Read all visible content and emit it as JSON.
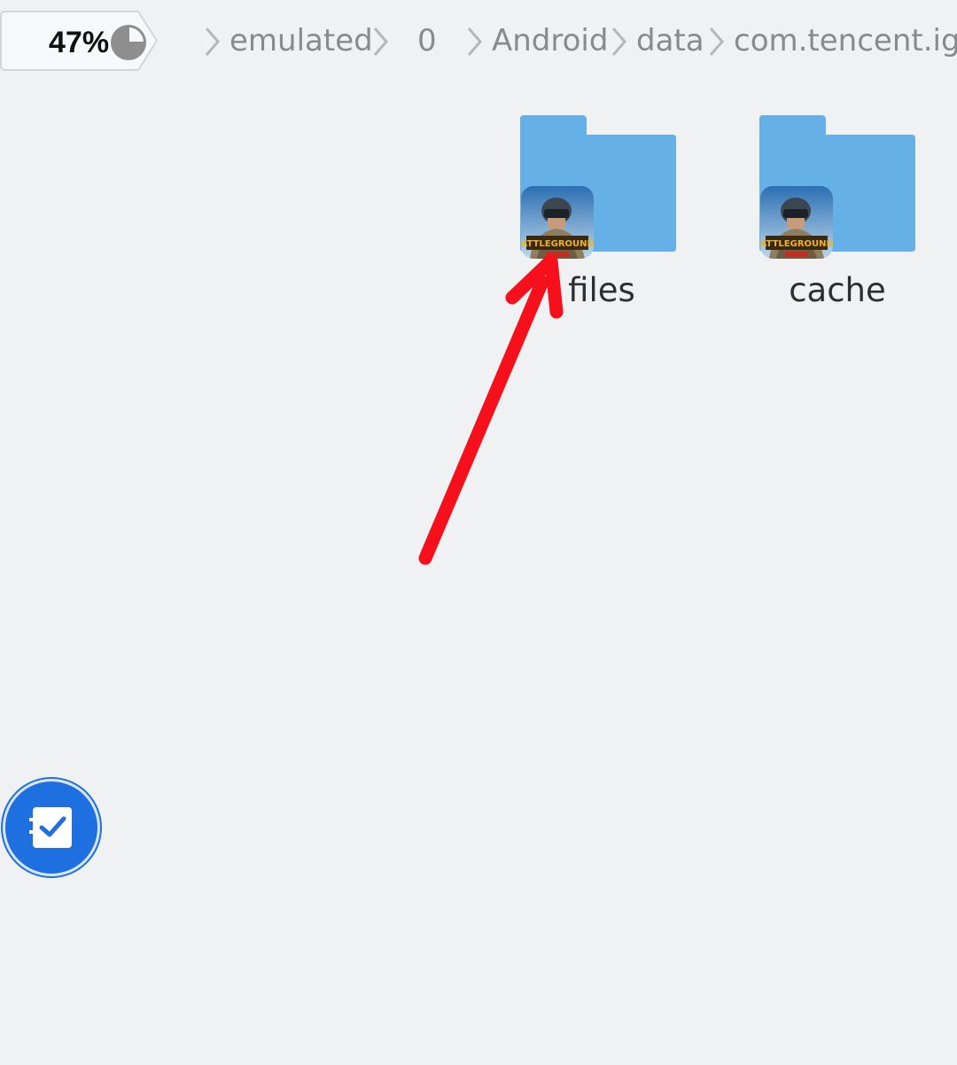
{
  "storage": {
    "percent_label": "47%",
    "used_fraction": 0.75
  },
  "breadcrumb": {
    "items": [
      "emulated",
      "0",
      "Android",
      "data",
      "com.tencent.ig"
    ]
  },
  "folders": [
    {
      "name": "files",
      "icon": "pubg-app-icon"
    },
    {
      "name": "cache",
      "icon": "pubg-app-icon"
    }
  ],
  "colors": {
    "background": "#eff1f3",
    "folder": "#66b0e8",
    "annotation_arrow": "#f5101c",
    "fab": "#1e6fe0",
    "breadcrumb_text": "#8a8a8a"
  },
  "fab": {
    "icon": "multi-select-checkbox-icon"
  }
}
